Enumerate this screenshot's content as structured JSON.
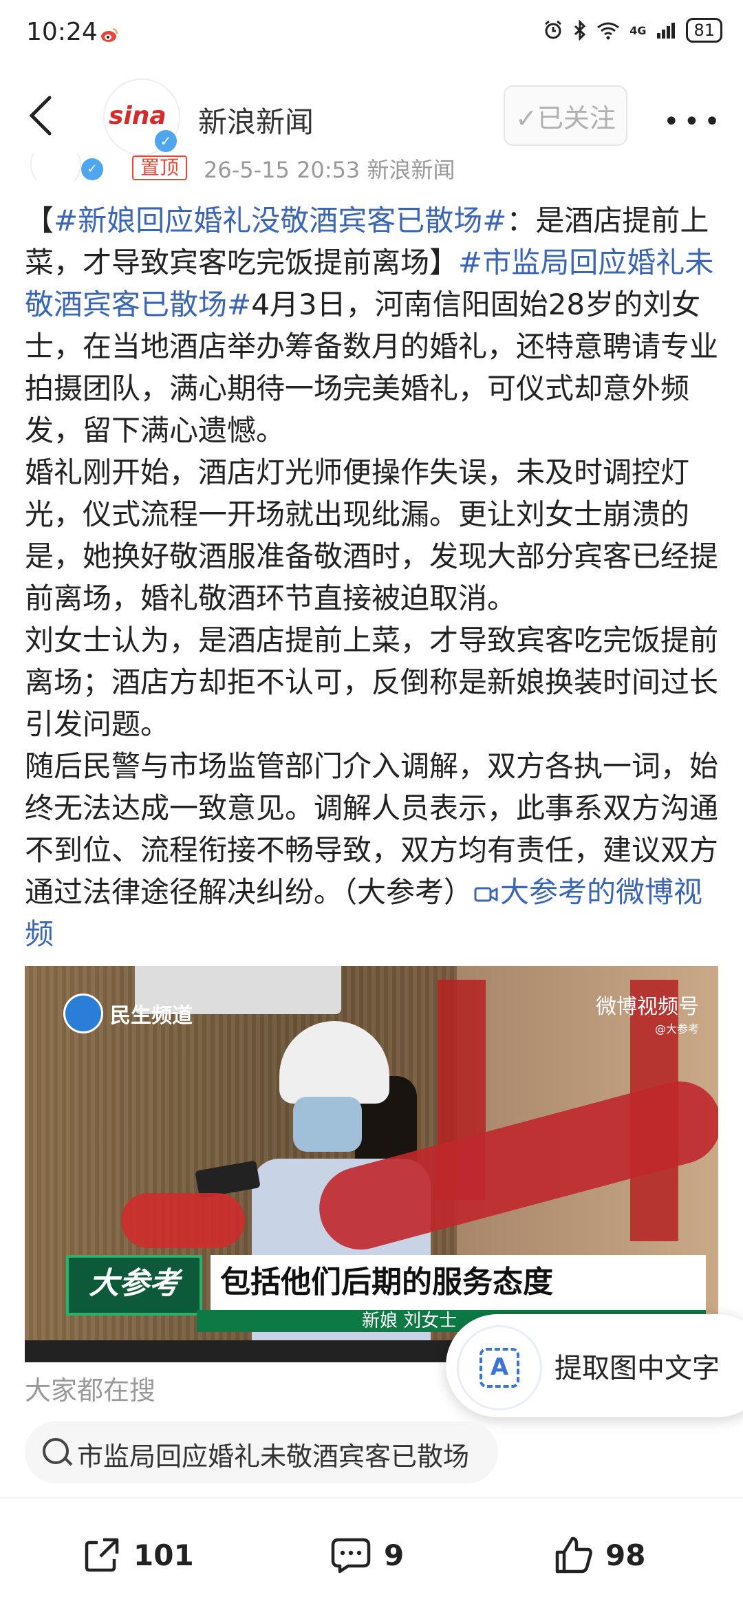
{
  "status_bar": {
    "time": "10:24",
    "right_icons": [
      "alarm-icon",
      "bluetooth-icon",
      "wifi-icon",
      "4g-signal-icon"
    ],
    "network": "4G",
    "battery": "81"
  },
  "header": {
    "account_name": "新浪新闻",
    "logo_text": "sina",
    "follow_label": "✓已关注",
    "more_label": "•••"
  },
  "post_meta": {
    "top_tag": "置顶",
    "time_source": "26-5-15 20:53  新浪新闻"
  },
  "post": {
    "p1_open": "【",
    "p1_tag1": "#新娘回应婚礼没敬酒宾客已散场#",
    "p1_mid": "：是酒店提前上菜，才导致宾客吃完饭提前离场】",
    "p1_tag2": "#市监局回应婚礼未敬酒宾客已散场#",
    "p1_rest": "4月3日，河南信阳固始28岁的刘女士，在当地酒店举办筹备数月的婚礼，还特意聘请专业拍摄团队，满心期待一场完美婚礼，可仪式却意外频发，留下满心遗憾。",
    "p2": "婚礼刚开始，酒店灯光师便操作失误，未及时调控灯光，仪式流程一开场就出现纰漏。更让刘女士崩溃的是，她换好敬酒服准备敬酒时，发现大部分宾客已经提前离场，婚礼敬酒环节直接被迫取消。",
    "p3": "刘女士认为，是酒店提前上菜，才导致宾客吃完饭提前离场；酒店方却拒不认可，反倒称是新娘换装时间过长引发问题。",
    "p4": "随后民警与市场监管部门介入调解，双方各执一词，始终无法达成一致意见。调解人员表示，此事系双方沟通不到位、流程衔接不畅导致，双方均有责任，建议双方通过法律途径解决纠纷。（大参考）",
    "video_link": "大参考的微博视频"
  },
  "video": {
    "channel_logo": "民生频道",
    "watermark": "微博视频号",
    "watermark_sub": "@大参考",
    "lower_brand": "大参考",
    "lower_text": "包括他们后期的服务态度",
    "lower_sub": "新娘  刘女士"
  },
  "ocr": {
    "icon_letter": "A",
    "label": "提取图中文字"
  },
  "search": {
    "title": "大家都在搜",
    "query": "市监局回应婚礼未敬酒宾客已散场"
  },
  "toolbar": {
    "share_count": "101",
    "comment_count": "9",
    "like_count": "98"
  }
}
